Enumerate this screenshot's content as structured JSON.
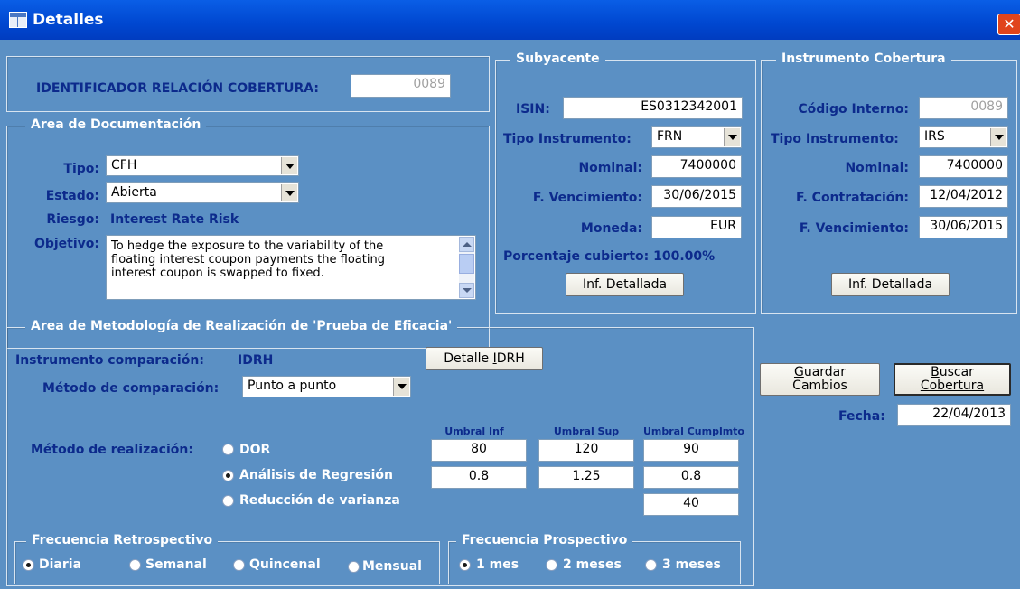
{
  "window": {
    "title": "Detalles",
    "close_glyph": "✕"
  },
  "id_relacion": {
    "label": "IDENTIFICADOR RELACIÓN COBERTURA:",
    "value": "0089"
  },
  "documentacion": {
    "legend": "Area de Documentación",
    "tipo_label": "Tipo:",
    "tipo_value": "CFH",
    "estado_label": "Estado:",
    "estado_value": "Abierta",
    "riesgo_label": "Riesgo:",
    "riesgo_value": "Interest Rate Risk",
    "objetivo_label": "Objetivo:",
    "objetivo_lines": [
      "To hedge the exposure to the variability of the",
      "floating interest coupon payments the floating",
      "interest coupon is swapped to fixed."
    ]
  },
  "subyacente": {
    "legend": "Subyacente",
    "isin_label": "ISIN:",
    "isin_value": "ES0312342001",
    "tipo_label": "Tipo Instrumento:",
    "tipo_value": "FRN",
    "nominal_label": "Nominal:",
    "nominal_value": "7400000",
    "vencimiento_label": "F. Vencimiento:",
    "vencimiento_value": "30/06/2015",
    "moneda_label": "Moneda:",
    "moneda_value": "EUR",
    "porcentaje_label": "Porcentaje cubierto: 100.00%",
    "detalle_button": "Inf. Detallada"
  },
  "instrumento": {
    "legend": "Instrumento Cobertura",
    "codigo_label": "Código Interno:",
    "codigo_value": "0089",
    "tipo_label": "Tipo Instrumento:",
    "tipo_value": "IRS",
    "nominal_label": "Nominal:",
    "nominal_value": "7400000",
    "contratacion_label": "F. Contratación:",
    "contratacion_value": "12/04/2012",
    "vencimiento_label": "F. Vencimiento:",
    "vencimiento_value": "30/06/2015",
    "detalle_button": "Inf. Detallada"
  },
  "metodologia": {
    "legend": "Area de Metodología de Realización de 'Prueba de Eficacia'",
    "instrumento_label": "Instrumento comparación:",
    "instrumento_value": "IDRH",
    "detalle_button_pre": "Detalle ",
    "detalle_button_key": "I",
    "detalle_button_post": "DRH",
    "metodo_comp_label": "Método de comparación:",
    "metodo_comp_value": "Punto a punto",
    "headers": {
      "inf": "Umbral Inf",
      "sup": "Umbral Sup",
      "cumpl": "Umbral Cumplmto"
    },
    "metodo_real_label": "Método de realización:",
    "options": [
      {
        "label": "DOR",
        "selected": false,
        "inf": "80",
        "sup": "120",
        "cumpl": "90"
      },
      {
        "label": "Análisis de Regresión",
        "selected": true,
        "inf": "0.8",
        "sup": "1.25",
        "cumpl": "0.8"
      },
      {
        "label": "Reducción de varianza",
        "selected": false,
        "cumpl": "40"
      }
    ]
  },
  "retrospectivo": {
    "legend": "Frecuencia Retrospectivo",
    "options": [
      {
        "label": "Diaria",
        "selected": true
      },
      {
        "label": "Semanal",
        "selected": false
      },
      {
        "label": "Quincenal",
        "selected": false
      },
      {
        "label": "Mensual",
        "selected": false
      }
    ]
  },
  "prospectivo": {
    "legend": "Frecuencia Prospectivo",
    "options": [
      {
        "label": "1 mes",
        "selected": true
      },
      {
        "label": "2 meses",
        "selected": false
      },
      {
        "label": "3 meses",
        "selected": false
      }
    ]
  },
  "actions": {
    "guardar_key": "G",
    "guardar_rest_line1": "uardar",
    "guardar_line2": "Cambios",
    "buscar_key": "B",
    "buscar_rest_line1": "uscar",
    "buscar_line2": "Cobertura",
    "fecha_label": "Fecha:",
    "fecha_value": "22/04/2013"
  }
}
